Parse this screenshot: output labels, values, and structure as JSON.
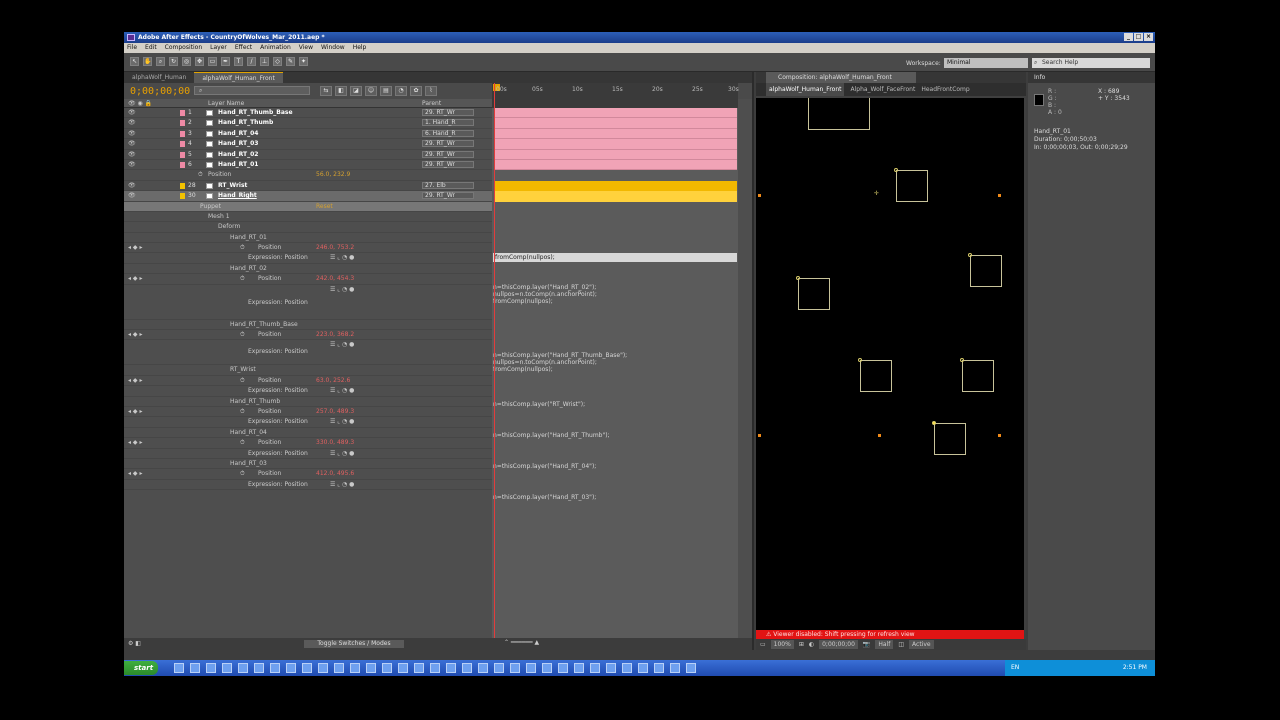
{
  "window": {
    "title": "Adobe After Effects - CountryOfWolves_Mar_2011.aep *",
    "buttons": [
      "_",
      "□",
      "×"
    ]
  },
  "menu": [
    "File",
    "Edit",
    "Composition",
    "Layer",
    "Effect",
    "Animation",
    "View",
    "Window",
    "Help"
  ],
  "toolbar": {
    "workspace_label": "Workspace:",
    "workspace_value": "Minimal",
    "search_placeholder": "Search Help"
  },
  "timeline": {
    "tabs": [
      "alphaWolf_Human",
      "alphaWolf_Human_Front"
    ],
    "timecode": "0;00;00;00",
    "search_value": "",
    "ruler_ticks": [
      "00s",
      "05s",
      "10s",
      "15s",
      "20s",
      "25s",
      "30s"
    ],
    "columns": {
      "layer_name": "Layer Name",
      "parent": "Parent"
    },
    "layers": [
      {
        "num": "1",
        "name": "Hand_RT_Thumb_Base",
        "parent": "29. RT_Wr"
      },
      {
        "num": "2",
        "name": "Hand_RT_Thumb",
        "parent": "1. Hand_R"
      },
      {
        "num": "3",
        "name": "Hand_RT_04",
        "parent": "6. Hand_R"
      },
      {
        "num": "4",
        "name": "Hand_RT_03",
        "parent": "29. RT_Wr"
      },
      {
        "num": "5",
        "name": "Hand_RT_02",
        "parent": "29. RT_Wr"
      },
      {
        "num": "6",
        "name": "Hand_RT_01",
        "parent": "29. RT_Wr"
      }
    ],
    "position_row": {
      "label": "Position",
      "value": "56.0, 232.9"
    },
    "layer28": {
      "num": "28",
      "name": "RT_Wrist",
      "parent": "27. Elb"
    },
    "layer30": {
      "num": "30",
      "name": "Hand_Right",
      "parent": "29. RT_Wr"
    },
    "puppet": {
      "label": "Puppet",
      "value": "Reset"
    },
    "mesh": "Mesh 1",
    "deform": "Deform",
    "pins": [
      {
        "name": "Hand_RT_01",
        "value": "246.0, 753.2",
        "expr_label": "Expression: Position",
        "expr": "fromComp(nullpos);"
      },
      {
        "name": "Hand_RT_02",
        "value": "242.0, 454.3",
        "expr_label": "Expression: Position",
        "expr": "n=thisComp.layer(\"Hand_RT_02\");\nnullpos=n.toComp(n.anchorPoint);\nfromComp(nullpos);"
      },
      {
        "name": "Hand_RT_Thumb_Base",
        "value": "223.0, 368.2",
        "expr_label": "Expression: Position",
        "expr": "n=thisComp.layer(\"Hand_RT_Thumb_Base\");\nnullpos=n.toComp(n.anchorPoint);\nfromComp(nullpos);"
      },
      {
        "name": "RT_Wrist",
        "value": "63.0, 252.6",
        "expr_label": "Expression: Position",
        "expr": "n=thisComp.layer(\"RT_Wrist\");"
      },
      {
        "name": "Hand_RT_Thumb",
        "value": "257.0, 489.3",
        "expr_label": "Expression: Position",
        "expr": "n=thisComp.layer(\"Hand_RT_Thumb\");"
      },
      {
        "name": "Hand_RT_04",
        "value": "330.0, 489.3",
        "expr_label": "Expression: Position",
        "expr": "n=thisComp.layer(\"Hand_RT_04\");"
      },
      {
        "name": "Hand_RT_03",
        "value": "412.0, 495.6",
        "expr_label": "Expression: Position",
        "expr": "n=thisComp.layer(\"Hand_RT_03\");"
      }
    ],
    "position_label": "Position",
    "footer_toggle": "Toggle Switches / Modes"
  },
  "composition": {
    "tab": "Composition: alphaWolf_Human_Front",
    "flow": [
      "alphaWolf_Human_Front",
      "Alpha_Wolf_FaceFront",
      "HeadFrontComp"
    ],
    "warning": "Viewer disabled: Shift pressing for refresh view",
    "footer": {
      "zoom": "100%",
      "time": "0;00;00;00",
      "res": "Half",
      "view": "Active"
    }
  },
  "info": {
    "tab": "Info",
    "rgba": "R :\nG :\nB :\nA : 0",
    "xy": "X : 689\n+ Y : 3543",
    "layer": "Hand_RT_01",
    "duration": "Duration: 0;00;50;03",
    "inout": "In: 0;00;00;03, Out: 0;00;29;29"
  },
  "taskbar": {
    "start": "start",
    "lang": "EN",
    "clock": "2:51 PM"
  },
  "colors": {
    "accent": "#e2a400",
    "pink_bar": "#f1a3b6",
    "orange_bar": "#f2b800",
    "warning": "#e11414",
    "value_red": "#e06060"
  }
}
